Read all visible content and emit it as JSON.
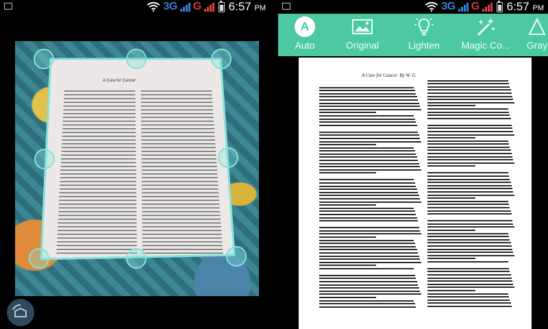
{
  "status_bar": {
    "network_1": "3G",
    "network_2": "G",
    "time": "6:57",
    "ampm": "PM"
  },
  "left_screen": {
    "document": {
      "title": "A Cure for Cancer",
      "byline": "By W. G."
    }
  },
  "right_screen": {
    "filters": [
      {
        "label": "Auto",
        "icon": "auto-icon",
        "letter": "A"
      },
      {
        "label": "Original",
        "icon": "image-icon"
      },
      {
        "label": "Lighten",
        "icon": "lightbulb-icon"
      },
      {
        "label": "Magic Co...",
        "icon": "magic-wand-icon"
      },
      {
        "label": "Gray",
        "icon": "gray-icon"
      }
    ],
    "active_filter": "Auto",
    "document": {
      "title": "A Cure for Cancer",
      "byline": "By W. G."
    }
  },
  "colors": {
    "toolbar": "#4cc9a3",
    "crop_handle": "#86e3d9"
  }
}
